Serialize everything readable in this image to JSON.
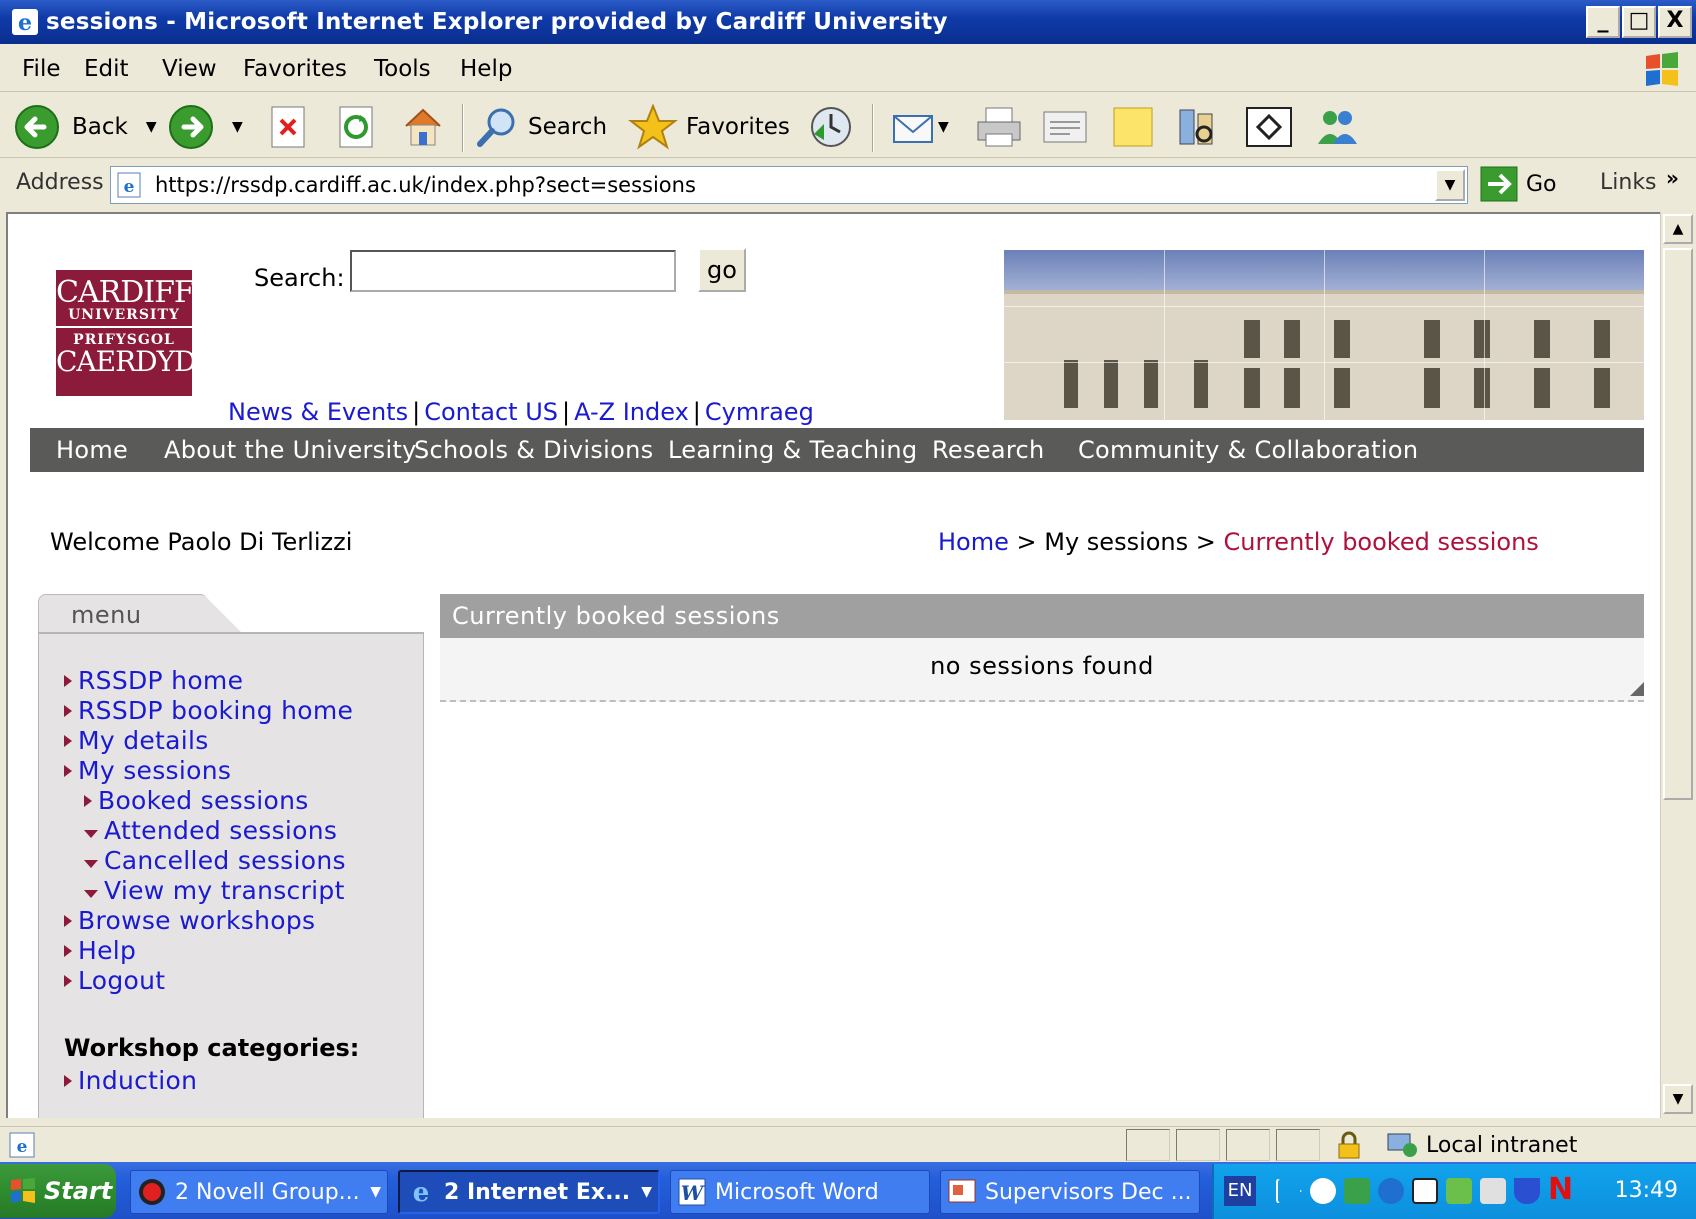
{
  "window": {
    "title": "sessions - Microsoft Internet Explorer provided by Cardiff University",
    "controls": [
      "_",
      "□",
      "X"
    ]
  },
  "menubar": [
    "File",
    "Edit",
    "View",
    "Favorites",
    "Tools",
    "Help"
  ],
  "toolbar": {
    "back_label": "Back",
    "search_label": "Search",
    "favorites_label": "Favorites"
  },
  "address": {
    "label": "Address",
    "url": "https://rssdp.cardiff.ac.uk/index.php?sect=sessions",
    "go_label": "Go",
    "links_label": "Links"
  },
  "page": {
    "logo": {
      "line1": "CARDIFF",
      "line2": "UNIVERSITY",
      "line3": "PRIFYSGOL",
      "line4": "CAERDYD"
    },
    "search": {
      "label": "Search:",
      "value": "",
      "button": "go"
    },
    "top_links": [
      "News & Events",
      "Contact US",
      "A-Z Index",
      "Cymraeg"
    ],
    "nav": [
      "Home",
      "About the University",
      "Schools & Divisions",
      "Learning & Teaching",
      "Research",
      "Community & Collaboration"
    ],
    "welcome": "Welcome Paolo Di Terlizzi",
    "breadcrumb": {
      "home": "Home",
      "sep": ">",
      "middle": "My sessions",
      "current": "Currently booked sessions"
    },
    "menu": {
      "title": "menu",
      "items": [
        {
          "label": "RSSDP home"
        },
        {
          "label": "RSSDP booking home"
        },
        {
          "label": "My details"
        },
        {
          "label": "My sessions"
        },
        {
          "label": "Booked sessions"
        },
        {
          "label": "Attended sessions"
        },
        {
          "label": "Cancelled sessions"
        },
        {
          "label": "View my transcript"
        },
        {
          "label": "Browse workshops"
        },
        {
          "label": "Help"
        },
        {
          "label": "Logout"
        }
      ],
      "categories_heading": "Workshop categories:",
      "categories": [
        "Induction"
      ]
    },
    "panel": {
      "title": "Currently booked sessions",
      "empty_message": "no sessions found"
    }
  },
  "statusbar": {
    "zone": "Local intranet"
  },
  "taskbar": {
    "start": "Start",
    "tasks": [
      "2 Novell Group...",
      "2 Internet Ex...",
      "Microsoft Word",
      "Supervisors Dec ..."
    ],
    "lang": "EN",
    "clock": "13:49"
  },
  "colors": {
    "title_bar": "#0f3ba8",
    "brand": "#8c1a3a",
    "nav_bar": "#5a5a58",
    "link": "#1a1ad0",
    "breadcrumb_current": "#b0103c",
    "panel_header": "#a0a0a0"
  }
}
